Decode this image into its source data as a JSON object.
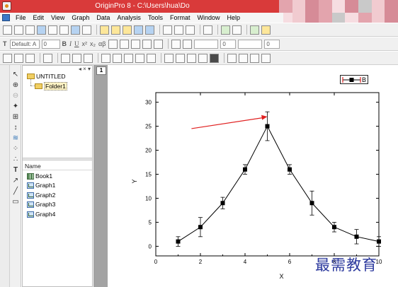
{
  "window": {
    "title": "OriginPro 8 - C:\\Users\\hua\\Do"
  },
  "menu": [
    "File",
    "Edit",
    "View",
    "Graph",
    "Data",
    "Analysis",
    "Tools",
    "Format",
    "Window",
    "Help"
  ],
  "format_toolbar": {
    "font": "Default: A",
    "font_size": "0",
    "bold": "B",
    "italic": "I",
    "underline": "U",
    "superscript": "x²",
    "subscript": "x₂",
    "greek": "αβ",
    "line_width": "0"
  },
  "explorer": {
    "root": "UNTITLED",
    "folder": "Folder1",
    "name_header": "Name",
    "items": [
      {
        "name": "Book1",
        "type": "book"
      },
      {
        "name": "Graph1",
        "type": "graph"
      },
      {
        "name": "Graph2",
        "type": "graph"
      },
      {
        "name": "Graph3",
        "type": "graph"
      },
      {
        "name": "Graph4",
        "type": "graph"
      }
    ]
  },
  "page_tab": "1",
  "legend": {
    "label": "B"
  },
  "chart_data": {
    "type": "line",
    "title": "",
    "xlabel": "X",
    "ylabel": "Y",
    "xlim": [
      0,
      10
    ],
    "ylim": [
      -2,
      32
    ],
    "xticks": [
      0,
      2,
      4,
      6,
      8,
      10
    ],
    "yticks": [
      0,
      5,
      10,
      15,
      20,
      25,
      30
    ],
    "series": [
      {
        "name": "B",
        "color": "#000000",
        "marker": "square",
        "x": [
          1,
          2,
          3,
          4,
          5,
          6,
          7,
          8,
          9,
          10
        ],
        "y": [
          1,
          4,
          9,
          16,
          25,
          16,
          9,
          4,
          2,
          1
        ],
        "error": [
          1,
          2,
          1.2,
          1,
          3,
          1,
          2.5,
          1,
          1.5,
          1
        ]
      }
    ],
    "annotation": {
      "type": "arrow",
      "color": "#e02020",
      "from": [
        1.6,
        24.5
      ],
      "to": [
        5,
        27
      ]
    }
  },
  "watermark": "最需教育"
}
